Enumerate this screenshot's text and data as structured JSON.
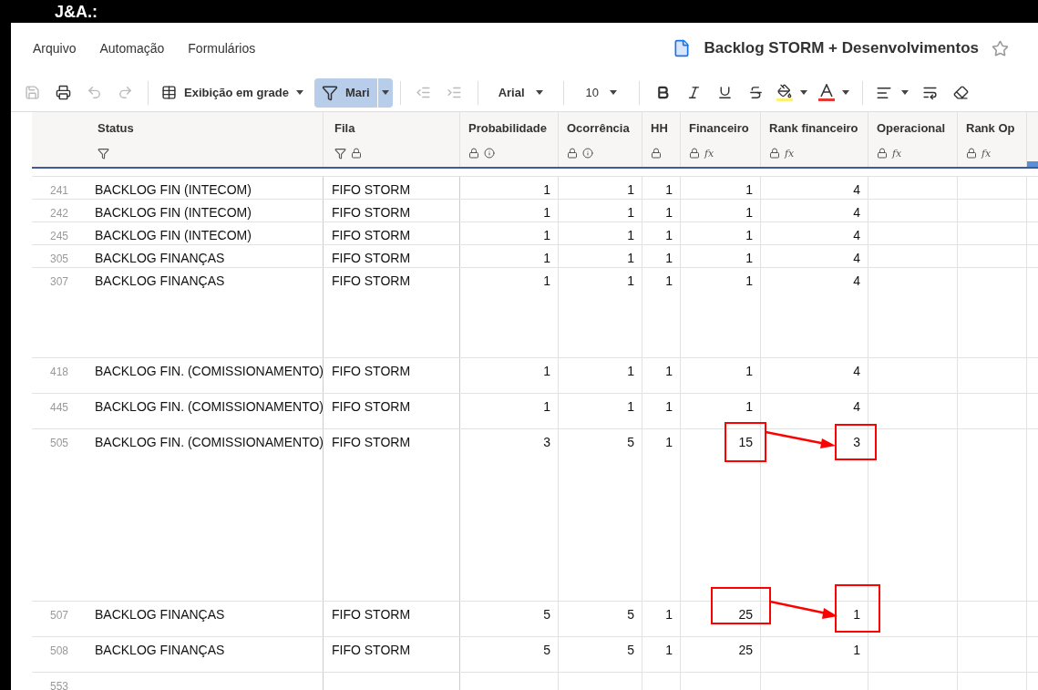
{
  "brand": "J&A.:",
  "menu": [
    {
      "label": "Arquivo"
    },
    {
      "label": "Automação"
    },
    {
      "label": "Formulários"
    }
  ],
  "document": {
    "title": "Backlog STORM + Desenvolvimentos",
    "starred": false
  },
  "toolbar": {
    "save_disabled": true,
    "undo_disabled": true,
    "redo_disabled": true,
    "indent_disabled": true,
    "view": "Exibição em grade",
    "filter": {
      "label": "Mari",
      "selected": true
    },
    "font": "Arial",
    "size": "10"
  },
  "table": {
    "columns": [
      {
        "label": "Status",
        "icons": [
          {
            "kind": "filter"
          }
        ]
      },
      {
        "label": "Fila",
        "icons": [
          {
            "kind": "filter"
          },
          {
            "kind": "lock"
          }
        ]
      },
      {
        "label": "Probabilidade",
        "icons": [
          {
            "kind": "lock"
          },
          {
            "kind": "info"
          }
        ]
      },
      {
        "label": "Ocorrência",
        "icons": [
          {
            "kind": "lock"
          },
          {
            "kind": "info"
          }
        ]
      },
      {
        "label": "HH",
        "icons": [
          {
            "kind": "lock"
          }
        ]
      },
      {
        "label": "Financeiro",
        "icons": [
          {
            "kind": "lock"
          },
          {
            "kind": "formula",
            "text": "fx"
          }
        ]
      },
      {
        "label": "Rank financeiro",
        "icons": [
          {
            "kind": "lock"
          },
          {
            "kind": "formula",
            "text": "fx"
          }
        ]
      },
      {
        "label": "Operacional",
        "icons": [
          {
            "kind": "lock"
          },
          {
            "kind": "formula",
            "text": "fx"
          }
        ]
      },
      {
        "label": "Rank Op",
        "icons": [
          {
            "kind": "lock"
          },
          {
            "kind": "formula",
            "text": "fx"
          }
        ]
      }
    ],
    "rows": [
      {
        "number": "241",
        "highlight": false,
        "cells": [
          "BACKLOG FIN (INTECOM)",
          "FIFO STORM",
          "1",
          "1",
          "1",
          "1",
          "4"
        ]
      },
      {
        "number": "242",
        "highlight": false,
        "cells": [
          "BACKLOG FIN (INTECOM)",
          "FIFO STORM",
          "1",
          "1",
          "1",
          "1",
          "4"
        ]
      },
      {
        "number": "245",
        "highlight": false,
        "cells": [
          "BACKLOG FIN (INTECOM)",
          "FIFO STORM",
          "1",
          "1",
          "1",
          "1",
          "4"
        ]
      },
      {
        "number": "305",
        "highlight": false,
        "cells": [
          "BACKLOG FINANÇAS",
          "FIFO STORM",
          "1",
          "1",
          "1",
          "1",
          "4"
        ]
      },
      {
        "number": "307",
        "highlight": false,
        "cells": [
          "BACKLOG FINANÇAS",
          "FIFO STORM",
          "1",
          "1",
          "1",
          "1",
          "4"
        ]
      },
      {
        "number": "418",
        "highlight": false,
        "cells": [
          "BACKLOG FIN. (COMISSIONAMENTO)",
          "FIFO STORM",
          "1",
          "1",
          "1",
          "1",
          "4"
        ]
      },
      {
        "number": "445",
        "highlight": false,
        "cells": [
          "BACKLOG FIN. (COMISSIONAMENTO)",
          "FIFO STORM",
          "1",
          "1",
          "1",
          "1",
          "4"
        ]
      },
      {
        "number": "505",
        "highlight": true,
        "cells": [
          "BACKLOG FIN. (COMISSIONAMENTO)",
          "FIFO STORM",
          "3",
          "5",
          "1",
          "15",
          "3"
        ]
      },
      {
        "number": "507",
        "highlight": true,
        "cells": [
          "BACKLOG FINANÇAS",
          "FIFO STORM",
          "5",
          "5",
          "1",
          "25",
          "1"
        ]
      },
      {
        "number": "508",
        "highlight": false,
        "cells": [
          "BACKLOG FINANÇAS",
          "FIFO STORM",
          "5",
          "5",
          "1",
          "25",
          "1"
        ]
      },
      {
        "number": "553",
        "highlight": false,
        "cells": []
      }
    ]
  }
}
